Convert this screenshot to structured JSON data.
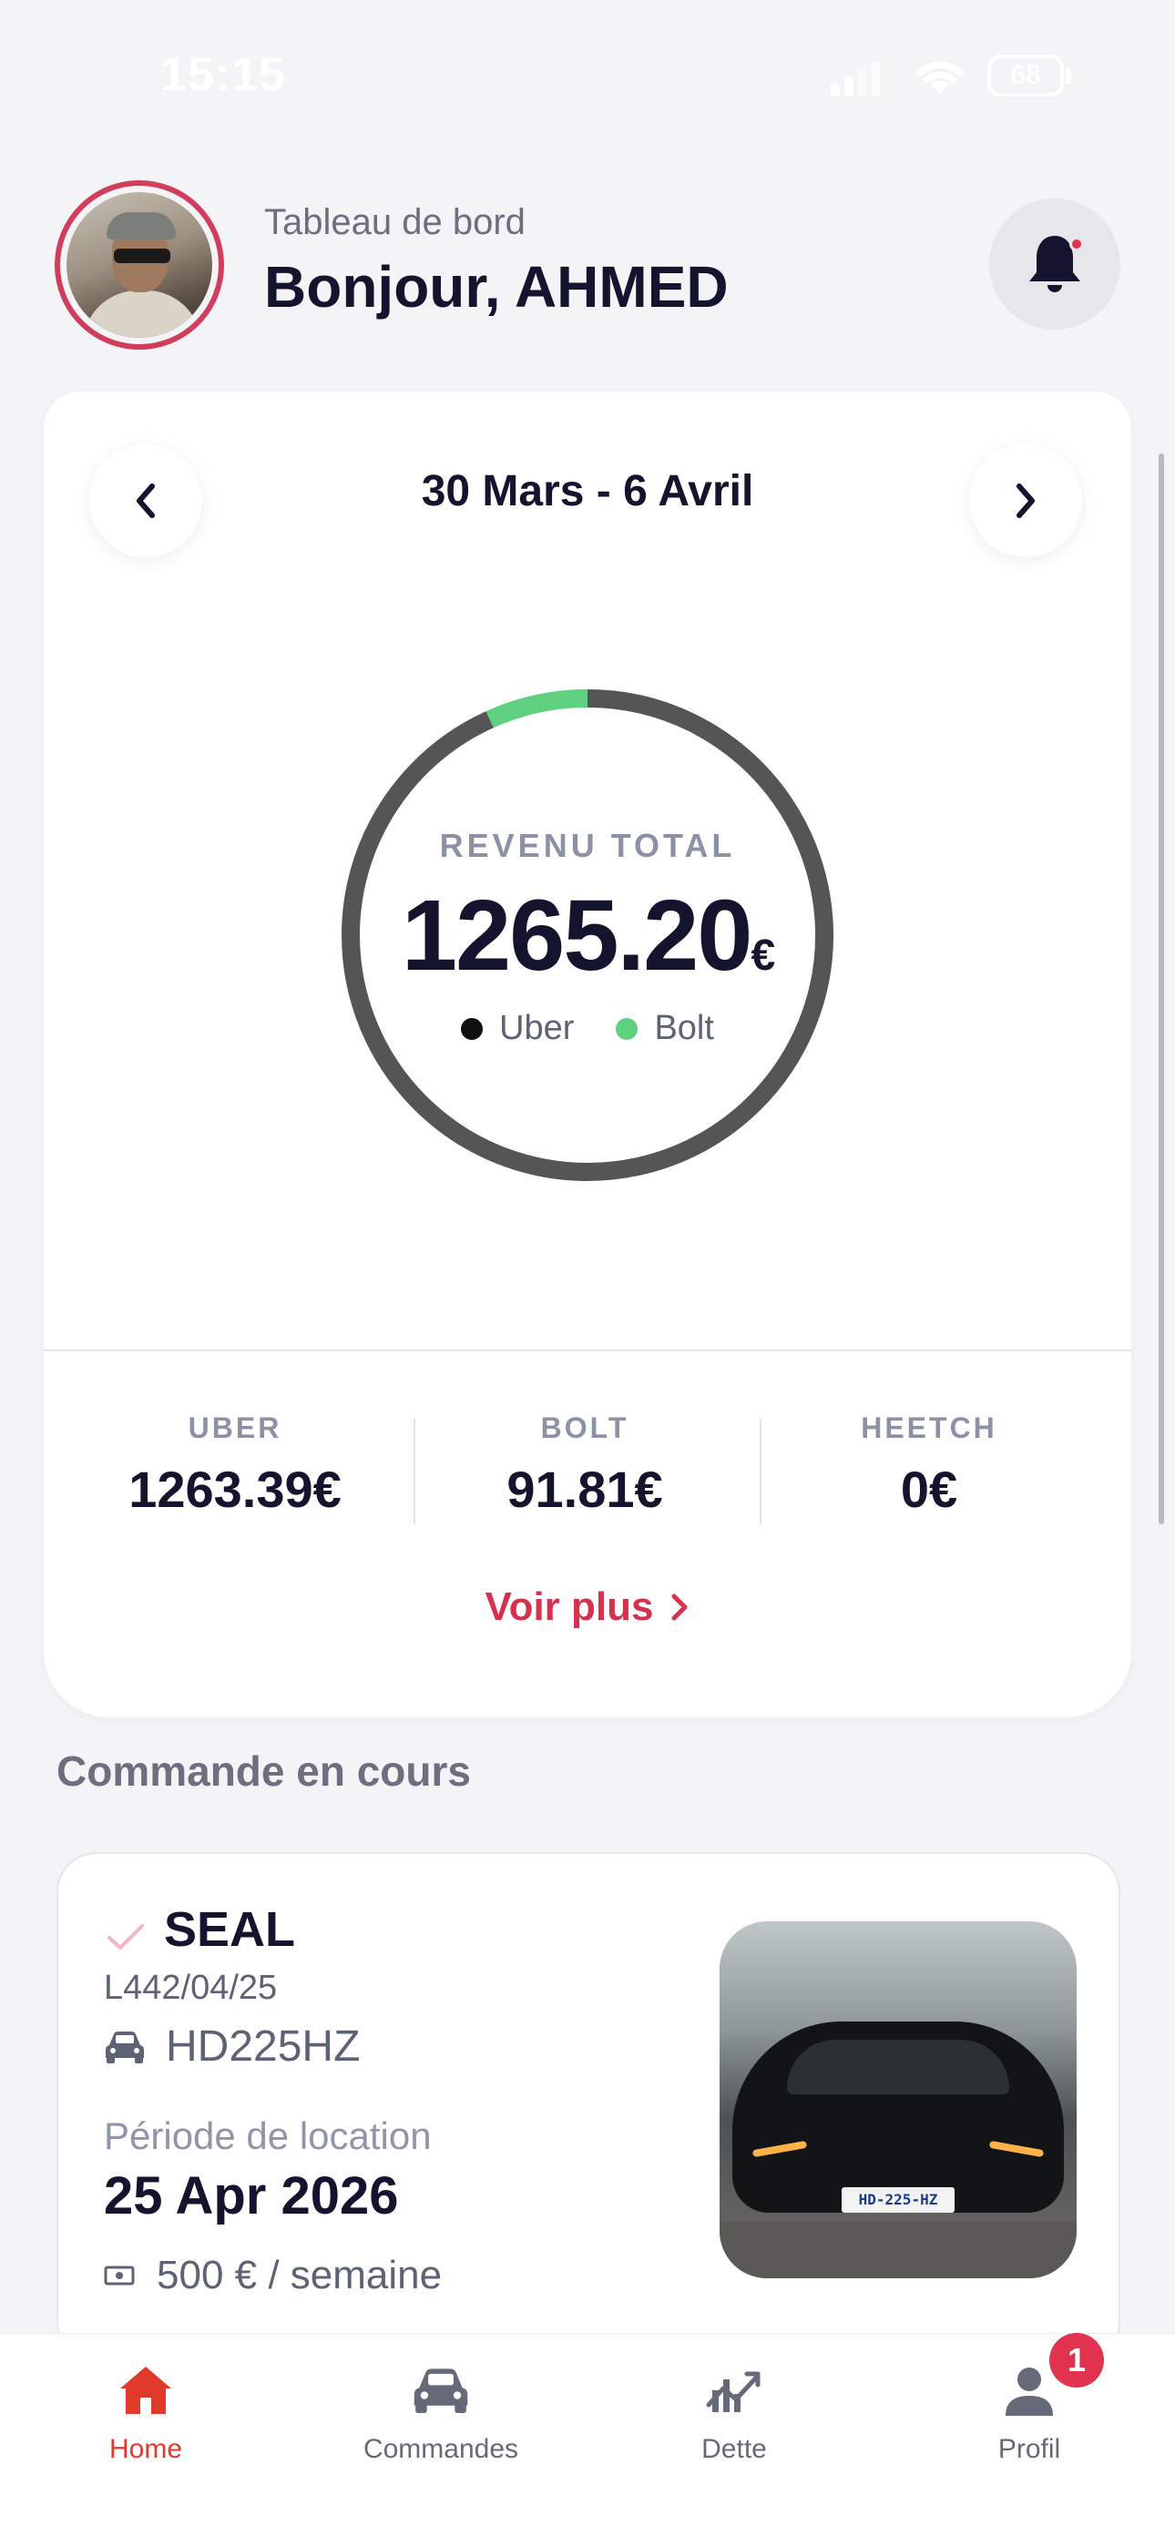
{
  "status_bar": {
    "time": "15:15",
    "battery": "68"
  },
  "header": {
    "subtitle": "Tableau de bord",
    "greeting": "Bonjour, AHMED"
  },
  "revenue": {
    "period": "30 Mars - 6 Avril",
    "caption": "REVENU TOTAL",
    "amount": "1265.20",
    "currency": "€",
    "legend": [
      {
        "label": "Uber",
        "color": "#111111"
      },
      {
        "label": "Bolt",
        "color": "#5fcf80"
      }
    ],
    "platforms": [
      {
        "label": "UBER",
        "value": "1263.39€"
      },
      {
        "label": "BOLT",
        "value": "91.81€"
      },
      {
        "label": "HEETCH",
        "value": "0€"
      }
    ],
    "more_label": "Voir plus"
  },
  "chart_data": {
    "type": "pie",
    "categories": [
      "Uber",
      "Bolt"
    ],
    "values": [
      1263.39,
      91.81
    ],
    "colors": [
      "#555555",
      "#5fcf80"
    ]
  },
  "orders_section": {
    "title": "Commande en cours",
    "order": {
      "model": "SEAL",
      "reference": "L442/04/25",
      "plate": "HD225HZ",
      "period_label": "Période de location",
      "date": "25 Apr 2026",
      "price": "500 € / semaine",
      "photo_plate": "HD-225-HZ"
    }
  },
  "tabs": [
    {
      "label": "Home",
      "icon": "home-icon",
      "active": true
    },
    {
      "label": "Commandes",
      "icon": "car-icon",
      "active": false
    },
    {
      "label": "Dette",
      "icon": "chart-icon",
      "active": false
    },
    {
      "label": "Profil",
      "icon": "user-icon",
      "active": false,
      "badge": "1"
    }
  ],
  "colors": {
    "accent": "#d6324f",
    "active_tab": "#e03a2c",
    "bolt_green": "#5fcf80"
  }
}
